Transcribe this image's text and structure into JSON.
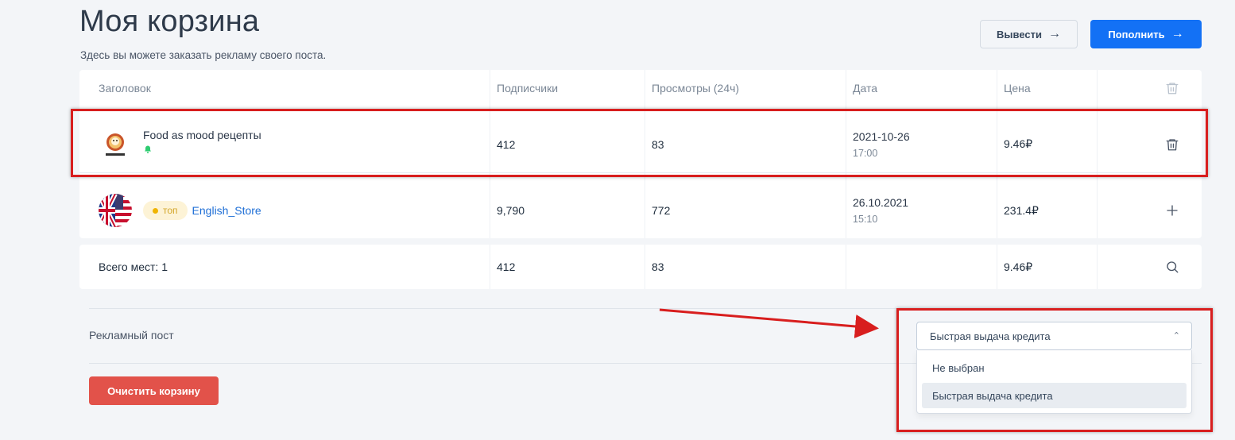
{
  "page": {
    "title": "Моя корзина",
    "subtitle": "Здесь вы можете заказать рекламу своего поста."
  },
  "actions": {
    "withdraw_label": "Вывести",
    "topup_label": "Пополнить",
    "clear_cart_label": "Очистить корзину"
  },
  "table": {
    "headers": {
      "title": "Заголовок",
      "subscribers": "Подписчики",
      "views": "Просмотры (24ч)",
      "date": "Дата",
      "price": "Цена"
    },
    "rows": [
      {
        "channel": "Food as mood рецепты",
        "subscribers": "412",
        "views": "83",
        "date": "2021-10-26",
        "time": "17:00",
        "price": "9.46₽",
        "action_icon": "trash-icon"
      },
      {
        "badge": "топ",
        "channel": "English_Store",
        "subscribers": "9,790",
        "views": "772",
        "date": "26.10.2021",
        "time": "15:10",
        "price": "231.4₽",
        "action_icon": "plus-icon"
      }
    ],
    "total": {
      "label": "Всего мест: 1",
      "subscribers": "412",
      "views": "83",
      "price": "9.46₽",
      "action_icon": "search-icon"
    }
  },
  "ad_post": {
    "label": "Рекламный пост",
    "selected": "Быстрая выдача кредита",
    "options": [
      "Не выбран",
      "Быстрая выдача кредита"
    ]
  },
  "colors": {
    "primary": "#1371f5",
    "danger": "#e2524a",
    "annotation": "#d81e1e",
    "badge_top": "#f0b400"
  }
}
